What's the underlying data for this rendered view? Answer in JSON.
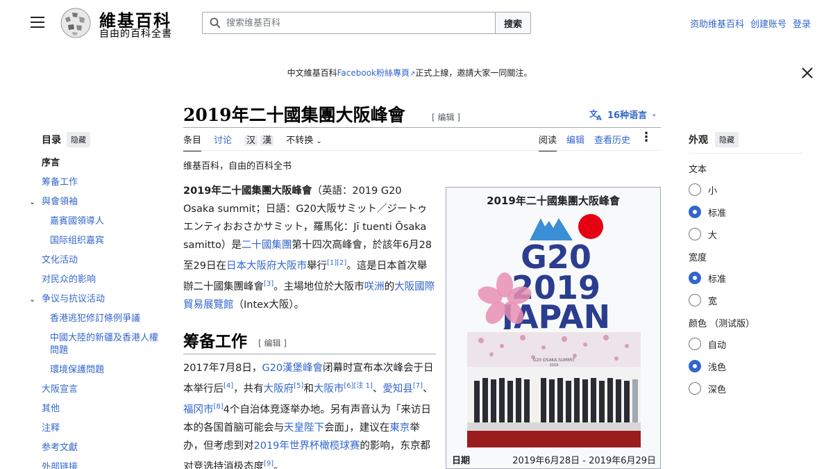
{
  "header": {
    "logo_title": "維基百科",
    "logo_tagline": "自由的百科全書",
    "search_placeholder": "搜索维基百科",
    "search_button": "搜索",
    "user_links": [
      "资助维基百科",
      "创建账号",
      "登录"
    ]
  },
  "banner": {
    "prefix": "中文維基百科",
    "link": "Facebook粉絲專頁",
    "suffix": "正式上線，邀請大家一同關注。"
  },
  "toc": {
    "title": "目录",
    "hide": "隐藏",
    "items": [
      {
        "label": "序言",
        "level": 1,
        "selected": true
      },
      {
        "label": "筹备工作",
        "level": 1
      },
      {
        "label": "與會領袖",
        "level": 1,
        "expandable": true
      },
      {
        "label": "嘉賓國領導人",
        "level": 2
      },
      {
        "label": "国际组织嘉宾",
        "level": 2
      },
      {
        "label": "文化活动",
        "level": 1
      },
      {
        "label": "对民众的影响",
        "level": 1
      },
      {
        "label": "争议与抗议活动",
        "level": 1,
        "expandable": true
      },
      {
        "label": "香港逃犯修訂條例爭議",
        "level": 2
      },
      {
        "label": "中國大陸的新疆及香港人權問題",
        "level": 2
      },
      {
        "label": "環境保護問題",
        "level": 2
      },
      {
        "label": "大阪宣言",
        "level": 1
      },
      {
        "label": "其他",
        "level": 1
      },
      {
        "label": "注释",
        "level": 1
      },
      {
        "label": "参考文獻",
        "level": 1
      },
      {
        "label": "外部链接",
        "level": 1
      }
    ]
  },
  "article": {
    "title": "2019年二十國集團大阪峰會",
    "edit": "[ 编辑 ]",
    "languages": "16种语言",
    "tabs_left": [
      "条目",
      "讨论"
    ],
    "variant_simplified": "汉",
    "variant_traditional": "漢",
    "variant_select": "不转换",
    "tabs_right": [
      "阅读",
      "编辑",
      "查看历史"
    ],
    "site_sub": "维基百科，自由的百科全书",
    "section_title": "筹备工作",
    "section_edit": "[ 编辑 ]"
  },
  "infobox": {
    "title": "2019年二十國集團大阪峰會",
    "logo_lines": [
      "G20",
      "2019",
      "JAPAN"
    ],
    "photo_caption": "G20 OSAKA SUMMIT",
    "photo_year": "2019",
    "date_label": "日期",
    "date_value": "2019年6月28日 - 2019年6月29日"
  },
  "appearance": {
    "title": "外观",
    "hide": "隐藏",
    "text_label": "文本",
    "text_options": [
      "小",
      "标准",
      "大"
    ],
    "text_selected": "标准",
    "width_label": "宽度",
    "width_options": [
      "标准",
      "宽"
    ],
    "width_selected": "标准",
    "color_label": "颜色 （测试版）",
    "color_options": [
      "自动",
      "浅色",
      "深色"
    ],
    "color_selected": "浅色"
  },
  "colors": {
    "link": "#3366cc",
    "red": "#e60012",
    "g20_blue": "#2a3d8f",
    "sakura": "#e78fb3",
    "fuji": "#3a8fd6"
  }
}
